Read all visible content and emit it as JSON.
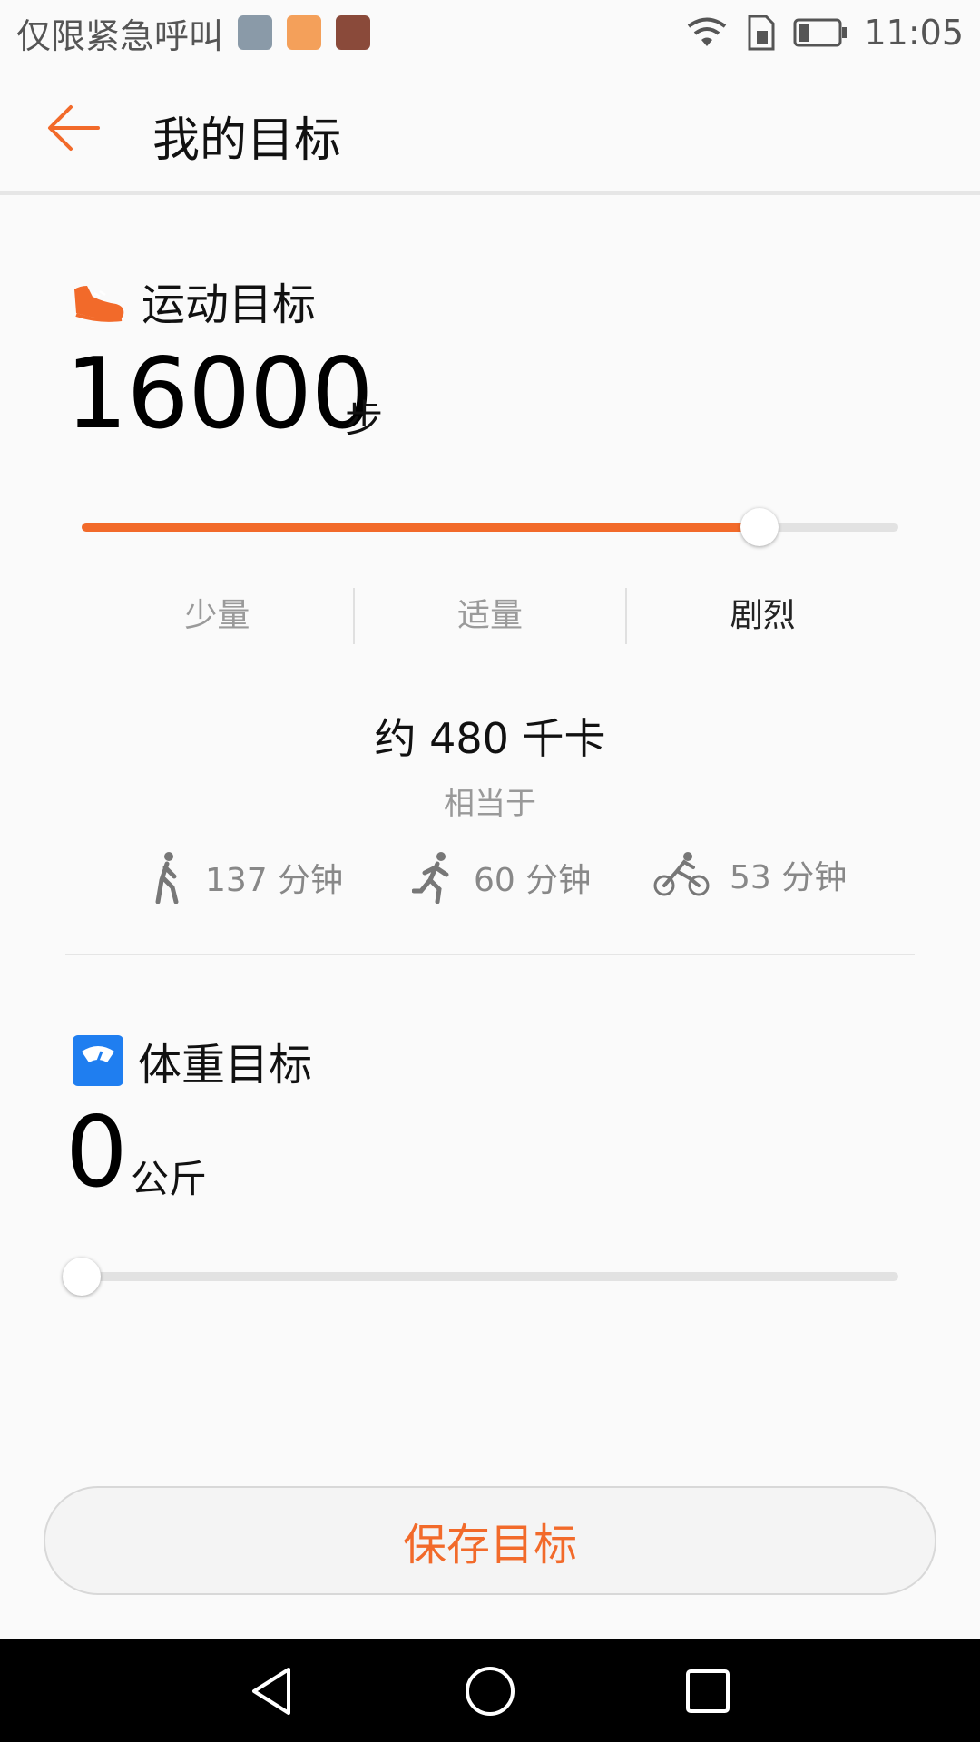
{
  "status_bar": {
    "carrier_text": "仅限紧急呼叫",
    "time": "11:05",
    "icons": [
      "gallery-notification-icon",
      "shop-notification-icon",
      "app-notification-icon",
      "wifi-icon",
      "sim-icon",
      "battery-icon"
    ]
  },
  "header": {
    "back_icon": "arrow-left-icon",
    "title": "我的目标"
  },
  "exercise": {
    "title": "运动目标",
    "icon": "shoe-icon",
    "value": "16000",
    "unit": "步",
    "slider_fraction": 0.83,
    "intensity_options": [
      "少量",
      "适量",
      "剧烈"
    ],
    "intensity_selected": "剧烈",
    "kcal_text": "约 480 千卡",
    "equivalent_label": "相当于",
    "activities": [
      {
        "icon": "walking-icon",
        "text": "137 分钟"
      },
      {
        "icon": "running-icon",
        "text": "60 分钟"
      },
      {
        "icon": "cycling-icon",
        "text": "53 分钟"
      }
    ]
  },
  "weight": {
    "title": "体重目标",
    "icon": "scale-icon",
    "value": "0",
    "unit": "公斤",
    "slider_fraction": 0.0
  },
  "save_button": "保存目标",
  "colors": {
    "accent": "#f26a2a",
    "weight_icon": "#1f7ef0"
  },
  "nav_bar": {
    "icons": [
      "back-triangle-icon",
      "home-circle-icon",
      "recents-square-icon"
    ]
  }
}
